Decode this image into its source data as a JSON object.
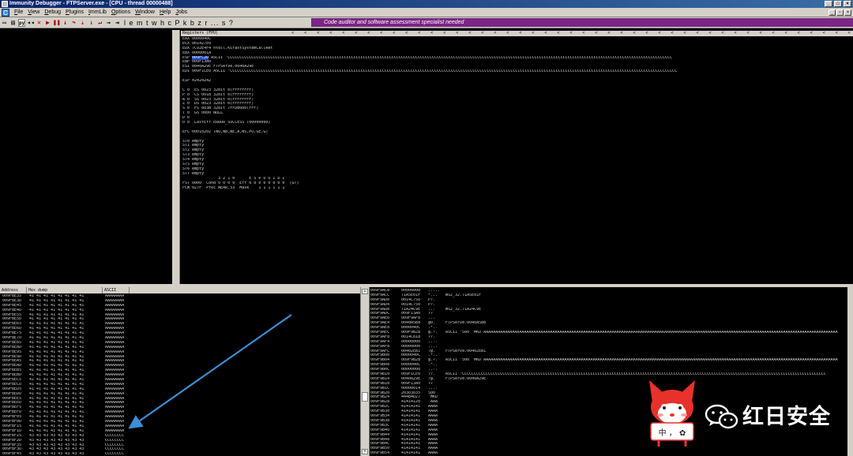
{
  "window": {
    "title": "Immunity Debugger - FTPServer.exe - [CPU - thread 00000488]"
  },
  "menu": [
    "File",
    "View",
    "Debug",
    "Plugins",
    "ImmLib",
    "Options",
    "Window",
    "Help",
    "Jobs"
  ],
  "toolbar": {
    "letters": "l e m t w h c P k b z r ... s ?",
    "banner": "Code auditor and software assessment specialist needed"
  },
  "registers": {
    "header": "Registers (FPU)",
    "lines": [
      "EAX 0000040C",
      "ECX 001427E0",
      "EDX 7C92E4F4 ntdll.KiFastSystemCallRet",
      "EBX 0000001A",
      "ESP 009FC2D ASCII \"CCCCCCCCCCCCCCCCCCCCCCCCCCCCCCCCCCCCCCCCCCCCCCCCCCCCCCCCCCCCCCCCCCCCCCCCCCCCCCCCCCCCCCCCCCCCCCCCCCCCCCCCCCCCCCCCCCCCCCCCCCCCCCCCCCCCCCCCCCCCCCCCCCCCCCCCCCCCCCCCCCCCCCCCCCCCCCCCCCCCCCCCCCC",
      "EBP 009F13A0",
      "ESI 0040A29E FTPServe.0040A29E",
      "EDI 009F1CE0 ASCII \"CCCCCCCCCCCCCCCCCCCCCCCCCCCCCCCCCCCCCCCCCCCCCCCCCCCCCCCCCCCCCCCCCCCCCCCCCCCCCCCCCCCCCCCCCCCCCCCCCCCCCCCCCCCCCCCCCCCCCCCCCCCCCCCCCCCCCCCCCCCCCCCCCCCCCCCCCCCCCCCCCCCCCCCCCCCCCCCCCCCCCCCCCCCC",
      "",
      "EIP 42424242",
      "",
      "C 0  ES 0023 32bit 0(FFFFFFFF)",
      "P 0  CS 001B 32bit 0(FFFFFFFF)",
      "A 0  SS 0023 32bit 0(FFFFFFFF)",
      "Z 0  DS 0023 32bit 0(FFFFFFFF)",
      "S 0  FS 003B 32bit 7FFDB000(FFF)",
      "T 0  GS 0000 NULL",
      "D 0",
      "O 0  LastErr ERROR_SUCCESS (00000000)",
      "",
      "EFL 00010202 (NO,NB,NE,A,NS,PO,GE,G)",
      "",
      "ST0 empty",
      "ST1 empty",
      "ST2 empty",
      "ST3 empty",
      "ST4 empty",
      "ST5 empty",
      "ST6 empty",
      "ST7 empty",
      "               3 2 1 0      E S P U O Z D I",
      "FST 0000  Cond 0 0 0 0  Err 0 0 0 0 0 0 0 0  (GT)",
      "FCW 027F  Prec NEAR,53  Mask    1 1 1 1 1 1"
    ],
    "esp_highlight": "009FC2D"
  },
  "dump": {
    "headers": [
      "Address",
      "Hex dump",
      "ASCII"
    ],
    "rows": [
      [
        "009FBE35",
        "41 41 41 41 41 41 41 41",
        "AAAAAAAA"
      ],
      [
        "009FBE3D",
        "41 41 41 41 41 41 41 41",
        "AAAAAAAA"
      ],
      [
        "009FBE45",
        "41 41 41 41 41 41 41 41",
        "AAAAAAAA"
      ],
      [
        "009FBE4D",
        "41 41 41 41 41 41 41 41",
        "AAAAAAAA"
      ],
      [
        "009FBE55",
        "41 41 41 41 41 41 41 41",
        "AAAAAAAA"
      ],
      [
        "009FBE5D",
        "41 41 41 41 41 41 41 41",
        "AAAAAAAA"
      ],
      [
        "009FBE65",
        "41 41 41 41 41 41 41 41",
        "AAAAAAAA"
      ],
      [
        "009FBE6D",
        "41 41 41 41 41 41 41 41",
        "AAAAAAAA"
      ],
      [
        "009FBE75",
        "41 41 41 41 41 41 41 41",
        "AAAAAAAA"
      ],
      [
        "009FBE7D",
        "41 41 41 41 41 41 41 41",
        "AAAAAAAA"
      ],
      [
        "009FBE85",
        "41 41 41 41 41 41 41 41",
        "AAAAAAAA"
      ],
      [
        "009FBE8D",
        "41 41 41 41 41 41 41 41",
        "AAAAAAAA"
      ],
      [
        "009FBE95",
        "41 41 41 41 41 41 41 41",
        "AAAAAAAA"
      ],
      [
        "009FBE9D",
        "41 41 41 41 41 41 41 41",
        "AAAAAAAA"
      ],
      [
        "009FBEA5",
        "41 41 41 41 41 41 41 41",
        "AAAAAAAA"
      ],
      [
        "009FBEAD",
        "41 41 41 41 41 41 41 41",
        "AAAAAAAA"
      ],
      [
        "009FBEB5",
        "41 41 41 41 41 41 41 41",
        "AAAAAAAA"
      ],
      [
        "009FBEBD",
        "41 41 41 41 41 41 41 41",
        "AAAAAAAA"
      ],
      [
        "009FBEC5",
        "41 41 41 41 41 41 41 41",
        "AAAAAAAA"
      ],
      [
        "009FBECD",
        "41 41 41 41 41 41 41 41",
        "AAAAAAAA"
      ],
      [
        "009FBED5",
        "41 41 41 41 41 41 41 41",
        "AAAAAAAA"
      ],
      [
        "009FBEDD",
        "41 41 41 41 41 41 41 41",
        "AAAAAAAA"
      ],
      [
        "009FBEE5",
        "41 41 41 41 41 41 41 41",
        "AAAAAAAA"
      ],
      [
        "009FBEED",
        "41 41 41 41 41 41 41 41",
        "AAAAAAAA"
      ],
      [
        "009FBEF5",
        "41 41 41 41 41 41 41 41",
        "AAAAAAAA"
      ],
      [
        "009FBEFD",
        "41 41 41 41 41 41 41 41",
        "AAAAAAAA"
      ],
      [
        "009FBF05",
        "41 41 41 41 41 41 41 41",
        "AAAAAAAA"
      ],
      [
        "009FBF0D",
        "41 41 41 41 41 41 41 41",
        "AAAAAAAA"
      ],
      [
        "009FBF15",
        "41 41 41 41 41 41 41 41",
        "AAAAAAAA"
      ],
      [
        "009FBF1D",
        "41 41 41 41 41 41 41 41",
        "AAAAAAAA"
      ],
      [
        "009FBF25",
        "43 43 43 43 43 43 43 43",
        "CCCCCCCC"
      ],
      [
        "009FBF2D",
        "43 43 43 43 43 43 43 43",
        "CCCCCCCC"
      ],
      [
        "009FBF35",
        "43 43 43 43 43 43 43 43",
        "CCCCCCCC"
      ],
      [
        "009FBF3D",
        "43 43 43 43 43 43 43 43",
        "CCCCCCCC"
      ],
      [
        "009FBF45",
        "43 43 43 43 43 43 43 43",
        "CCCCCCCC"
      ]
    ]
  },
  "stack": {
    "rows": [
      [
        "009F9AC8",
        "00000000",
        ".....",
        ""
      ],
      [
        "009F9ACC",
        "71A5E01F",
        "*...",
        "WS2_32.71A5E01F"
      ],
      [
        "009F9AD0",
        "0014C750",
        "P?.",
        ""
      ],
      [
        "009F9AD4",
        "0014C750",
        "P?.",
        ""
      ],
      [
        "009F9AD8",
        "71A24C9E",
        "...",
        "WS2_32.71A24C9E"
      ],
      [
        "009F9ADC",
        "009F13A0",
        "??",
        ""
      ],
      [
        "009F9AE0",
        "009F9AF8",
        "...",
        ""
      ],
      [
        "009F9AE4",
        "0040A5B8",
        "@0.",
        "FTPServe.0040A5B8"
      ],
      [
        "009F9AE8",
        "0000040C",
        ".*..",
        ""
      ],
      [
        "009F9AEC",
        "009F9B28",
        "@.?.",
        "ASCII \"500 'MKD AAAAAAAAAAAAAAAAAAAAAAAAAAAAAAAAAAAAAAAAAAAAAAAAAAAAAAAAAAAAAAAAAAAAAAAAAAAAAAAAAAAAAAAAAAAAAAAAAAAAAAAAAAAAAAAAAAAAAAAAAAAAAAAAAAAAAAAAAAAAAAAAAAAAA"
      ],
      [
        "009F9AF0",
        "0014C818",
        "??.",
        ""
      ],
      [
        "009F9AF4",
        "00000000",
        "....",
        ""
      ],
      [
        "009F9AF8",
        "00000000",
        "....",
        ""
      ],
      [
        "009F9AFC",
        "00402EB1",
        "?@.",
        "FTPServe.00402EB1"
      ],
      [
        "009F9B00",
        "0000040C",
        ".*..",
        ""
      ],
      [
        "009F9B04",
        "009F9B28",
        "@.?.",
        "ASCII \"500 'MKD AAAAAAAAAAAAAAAAAAAAAAAAAAAAAAAAAAAAAAAAAAAAAAAAAAAAAAAAAAAAAAAAAAAAAAAAAAAAAAAAAAAAAAAAAAAAAAAAAAAAAAAAAAAAAAAAAAAAAAAAAAAAAAAAAAAAAAAAAAAAAAAAAAAAA"
      ],
      [
        "009F9B08",
        "0000040C",
        ".*..",
        ""
      ],
      [
        "009F9B0C",
        "00000000",
        "....",
        ""
      ],
      [
        "009F9B10",
        "009F1CE0",
        "??.",
        "ASCII \"CCCCCCCCCCCCCCCCCCCCCCCCCCCCCCCCCCCCCCCCCCCCCCCCCCCCCCCCCCCCCCCCCCCCCCCCCCCCCCCCCCCCCCCCCCCCCCCCCCCCCCCCCCCCCCCCCCCCCCCCCCCCCCCCCCCCCCCCCCCCCCCCCCCCCCCCC"
      ],
      [
        "009F9B14",
        "0040A29E",
        "?@.",
        "FTPServe.0040A29E"
      ],
      [
        "009F9B18",
        "009F13A0",
        "??",
        ""
      ],
      [
        "009F9B1C",
        "00000014",
        "....",
        ""
      ],
      [
        "009F9B20",
        "20303035",
        "500",
        ""
      ],
      [
        "009F9B24",
        "444B4D27",
        "'MKD",
        ""
      ],
      [
        "009F9B28",
        "41414120",
        " AAA",
        ""
      ],
      [
        "009F9B2C",
        "41414141",
        "AAAA",
        ""
      ],
      [
        "009F9B30",
        "41414141",
        "AAAA",
        ""
      ],
      [
        "009F9B34",
        "41414141",
        "AAAA",
        ""
      ],
      [
        "009F9B38",
        "41414141",
        "AAAA",
        ""
      ],
      [
        "009F9B3C",
        "41414141",
        "AAAA",
        ""
      ],
      [
        "009F9B40",
        "41414141",
        "AAAA",
        ""
      ],
      [
        "009F9B44",
        "41414141",
        "AAAA",
        ""
      ],
      [
        "009F9B48",
        "41414141",
        "AAAA",
        ""
      ],
      [
        "009F9B4C",
        "41414141",
        "AAAA",
        ""
      ],
      [
        "009F9B50",
        "41414141",
        "AAAA",
        ""
      ],
      [
        "009F9B54",
        "41414141",
        "AAAA",
        ""
      ]
    ]
  },
  "watermark": {
    "brand": "红日安全",
    "badge": "中 ， ✿",
    "accent": "#e8312a",
    "arrow_color": "#3a8fd6"
  }
}
